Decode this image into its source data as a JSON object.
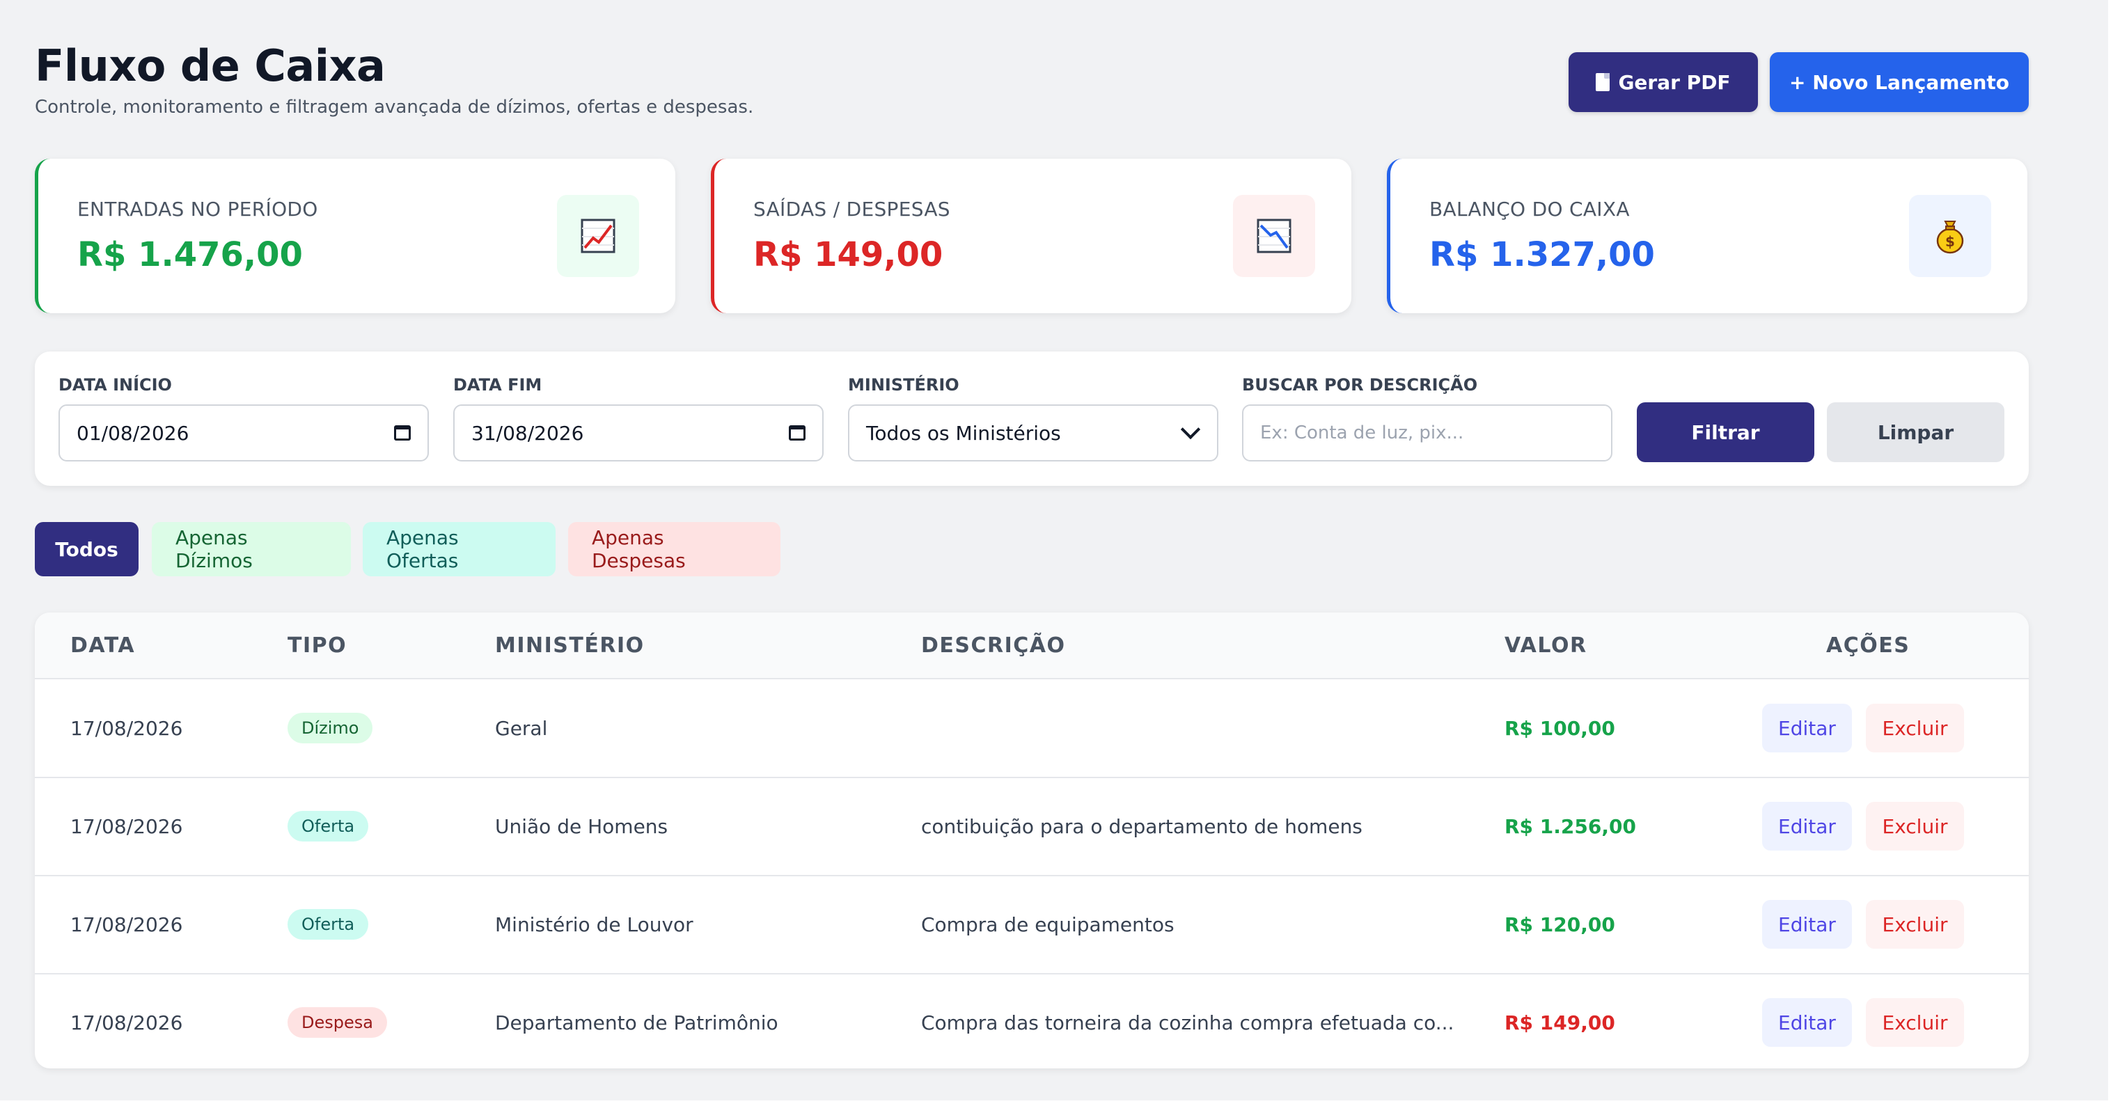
{
  "header": {
    "title": "Fluxo de Caixa",
    "subtitle": "Controle, monitoramento e filtragem avançada de dízimos, ofertas e despesas.",
    "pdf_button": "Gerar PDF",
    "new_button": "+ Novo Lançamento"
  },
  "summary": {
    "entradas": {
      "label": "ENTRADAS NO PERÍODO",
      "value": "R$ 1.476,00",
      "icon": "chart-up-icon",
      "color": "#16a34a"
    },
    "saidas": {
      "label": "SAÍDAS / DESPESAS",
      "value": "R$ 149,00",
      "icon": "chart-down-icon",
      "color": "#dc2626"
    },
    "balanco": {
      "label": "BALANÇO DO CAIXA",
      "value": "R$ 1.327,00",
      "icon": "money-bag-icon",
      "color": "#2563eb"
    }
  },
  "filters": {
    "data_inicio": {
      "label": "DATA INÍCIO",
      "value": "01/08/2026"
    },
    "data_fim": {
      "label": "DATA FIM",
      "value": "31/08/2026"
    },
    "ministerio": {
      "label": "MINISTÉRIO",
      "value": "Todos os Ministérios"
    },
    "busca": {
      "label": "BUSCAR POR DESCRIÇÃO",
      "placeholder": "Ex: Conta de luz, pix..."
    },
    "filtrar_button": "Filtrar",
    "limpar_button": "Limpar"
  },
  "tabs": {
    "todos": "Todos",
    "dizimos": "Apenas Dízimos",
    "ofertas": "Apenas Ofertas",
    "despesas": "Apenas Despesas",
    "active": "Todos"
  },
  "table": {
    "headers": {
      "data": "DATA",
      "tipo": "TIPO",
      "ministerio": "MINISTÉRIO",
      "descricao": "DESCRIÇÃO",
      "valor": "VALOR",
      "acoes": "AÇÕES"
    },
    "rows": [
      {
        "data": "17/08/2026",
        "tipo": "Dízimo",
        "ministerio": "Geral",
        "descricao": "",
        "valor": "R$ 100,00",
        "edit": "Editar",
        "delete": "Excluir"
      },
      {
        "data": "17/08/2026",
        "tipo": "Oferta",
        "ministerio": "União de Homens",
        "descricao": "contibuição para o departamento de homens",
        "valor": "R$ 1.256,00",
        "edit": "Editar",
        "delete": "Excluir"
      },
      {
        "data": "17/08/2026",
        "tipo": "Oferta",
        "ministerio": "Ministério de Louvor",
        "descricao": "Compra de equipamentos",
        "valor": "R$ 120,00",
        "edit": "Editar",
        "delete": "Excluir"
      },
      {
        "data": "17/08/2026",
        "tipo": "Despesa",
        "ministerio": "Departamento de Patrimônio",
        "descricao": "Compra das torneira da cozinha compra efetuada co...",
        "valor": "R$ 149,00",
        "edit": "Editar",
        "delete": "Excluir"
      }
    ]
  }
}
